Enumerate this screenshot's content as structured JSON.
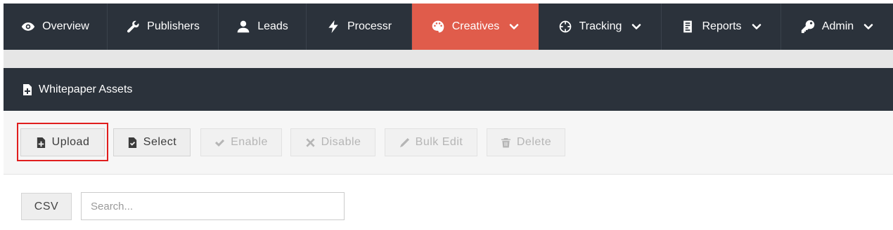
{
  "nav": {
    "items": [
      {
        "label": "Overview",
        "icon": "eye-icon",
        "dropdown": false
      },
      {
        "label": "Publishers",
        "icon": "wrench-icon",
        "dropdown": false
      },
      {
        "label": "Leads",
        "icon": "user-icon",
        "dropdown": false
      },
      {
        "label": "Processr",
        "icon": "bolt-icon",
        "dropdown": false
      },
      {
        "label": "Creatives",
        "icon": "palette-icon",
        "dropdown": true,
        "active": true
      },
      {
        "label": "Tracking",
        "icon": "crosshair-icon",
        "dropdown": true
      },
      {
        "label": "Reports",
        "icon": "report-icon",
        "dropdown": true
      },
      {
        "label": "Admin",
        "icon": "key-icon",
        "dropdown": true
      }
    ],
    "active_color": "#e05c4b",
    "background": "#2b323b"
  },
  "panel": {
    "title": "Whitepaper Assets",
    "icon": "file-plus-icon"
  },
  "toolbar": {
    "upload_label": "Upload",
    "select_label": "Select",
    "enable_label": "Enable",
    "disable_label": "Disable",
    "bulk_edit_label": "Bulk Edit",
    "delete_label": "Delete",
    "highlight_color": "#e01e1e"
  },
  "search": {
    "csv_label": "CSV",
    "placeholder": "Search...",
    "value": ""
  }
}
